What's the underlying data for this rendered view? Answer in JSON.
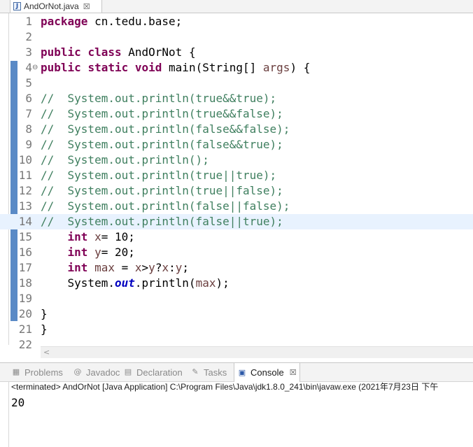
{
  "editor_tab": {
    "icon": "J",
    "label": "AndOrNot.java",
    "close": "☒"
  },
  "lines": [
    {
      "n": "1",
      "fold": "",
      "segs": [
        {
          "t": "package",
          "c": "kw"
        },
        {
          "t": " cn.tedu.base;",
          "c": ""
        }
      ]
    },
    {
      "n": "2",
      "fold": "",
      "segs": []
    },
    {
      "n": "3",
      "fold": "",
      "segs": [
        {
          "t": "public",
          "c": "kw"
        },
        {
          "t": " ",
          "c": ""
        },
        {
          "t": "class",
          "c": "kw"
        },
        {
          "t": " AndOrNot {",
          "c": ""
        }
      ]
    },
    {
      "n": "4",
      "fold": "⊖",
      "segs": [
        {
          "t": "public",
          "c": "kw"
        },
        {
          "t": " ",
          "c": ""
        },
        {
          "t": "static",
          "c": "kw"
        },
        {
          "t": " ",
          "c": ""
        },
        {
          "t": "void",
          "c": "kw"
        },
        {
          "t": " main(String[] ",
          "c": ""
        },
        {
          "t": "args",
          "c": "var"
        },
        {
          "t": ") {",
          "c": ""
        }
      ]
    },
    {
      "n": "5",
      "fold": "",
      "segs": []
    },
    {
      "n": "6",
      "fold": "",
      "segs": [
        {
          "t": "//  System.out.println(true&&true);",
          "c": "cm"
        }
      ]
    },
    {
      "n": "7",
      "fold": "",
      "segs": [
        {
          "t": "//  System.out.println(true&&false);",
          "c": "cm"
        }
      ]
    },
    {
      "n": "8",
      "fold": "",
      "segs": [
        {
          "t": "//  System.out.println(false&&false);",
          "c": "cm"
        }
      ]
    },
    {
      "n": "9",
      "fold": "",
      "segs": [
        {
          "t": "//  System.out.println(false&&true);",
          "c": "cm"
        }
      ]
    },
    {
      "n": "10",
      "fold": "",
      "segs": [
        {
          "t": "//  System.out.println();",
          "c": "cm"
        }
      ]
    },
    {
      "n": "11",
      "fold": "",
      "segs": [
        {
          "t": "//  System.out.println(true||true);",
          "c": "cm"
        }
      ]
    },
    {
      "n": "12",
      "fold": "",
      "segs": [
        {
          "t": "//  System.out.println(true||false);",
          "c": "cm"
        }
      ]
    },
    {
      "n": "13",
      "fold": "",
      "segs": [
        {
          "t": "//  System.out.println(false||false);",
          "c": "cm"
        }
      ]
    },
    {
      "n": "14",
      "fold": "",
      "current": true,
      "segs": [
        {
          "t": "//  System.out.println(false||true);",
          "c": "cm"
        }
      ]
    },
    {
      "n": "15",
      "fold": "",
      "segs": [
        {
          "t": "    ",
          "c": ""
        },
        {
          "t": "int",
          "c": "kw"
        },
        {
          "t": " ",
          "c": ""
        },
        {
          "t": "x",
          "c": "var"
        },
        {
          "t": "= 10;",
          "c": ""
        }
      ]
    },
    {
      "n": "16",
      "fold": "",
      "segs": [
        {
          "t": "    ",
          "c": ""
        },
        {
          "t": "int",
          "c": "kw"
        },
        {
          "t": " ",
          "c": ""
        },
        {
          "t": "y",
          "c": "var"
        },
        {
          "t": "= 20;",
          "c": ""
        }
      ]
    },
    {
      "n": "17",
      "fold": "",
      "segs": [
        {
          "t": "    ",
          "c": ""
        },
        {
          "t": "int",
          "c": "kw"
        },
        {
          "t": " ",
          "c": ""
        },
        {
          "t": "max",
          "c": "var"
        },
        {
          "t": " = ",
          "c": ""
        },
        {
          "t": "x",
          "c": "var"
        },
        {
          "t": ">",
          "c": ""
        },
        {
          "t": "y",
          "c": "var"
        },
        {
          "t": "?",
          "c": ""
        },
        {
          "t": "x",
          "c": "var"
        },
        {
          "t": ":",
          "c": ""
        },
        {
          "t": "y",
          "c": "var"
        },
        {
          "t": ";",
          "c": ""
        }
      ]
    },
    {
      "n": "18",
      "fold": "",
      "segs": [
        {
          "t": "    System.",
          "c": ""
        },
        {
          "t": "out",
          "c": "st"
        },
        {
          "t": ".println(",
          "c": ""
        },
        {
          "t": "max",
          "c": "var"
        },
        {
          "t": ");",
          "c": ""
        }
      ]
    },
    {
      "n": "19",
      "fold": "",
      "segs": []
    },
    {
      "n": "20",
      "fold": "",
      "segs": [
        {
          "t": "}",
          "c": ""
        }
      ]
    },
    {
      "n": "21",
      "fold": "",
      "segs": [
        {
          "t": "}",
          "c": ""
        }
      ]
    },
    {
      "n": "22",
      "fold": "",
      "segs": []
    }
  ],
  "scroll_arrow": "<",
  "panel_tabs": [
    {
      "name": "tab-problems",
      "icon": "problems-icon",
      "glyph": "▦",
      "label": "Problems",
      "active": false
    },
    {
      "name": "tab-javadoc",
      "icon": "javadoc-icon",
      "glyph": "@",
      "label": "Javadoc",
      "active": false
    },
    {
      "name": "tab-declaration",
      "icon": "declaration-icon",
      "glyph": "▤",
      "label": "Declaration",
      "active": false
    },
    {
      "name": "tab-tasks",
      "icon": "tasks-icon",
      "glyph": "✎",
      "label": "Tasks",
      "active": false
    },
    {
      "name": "tab-console",
      "icon": "console-icon",
      "glyph": "▣",
      "label": "Console",
      "active": true,
      "close": "☒"
    }
  ],
  "console": {
    "header": "<terminated> AndOrNot [Java Application] C:\\Program Files\\Java\\jdk1.8.0_241\\bin\\javaw.exe (2021年7月23日 下午",
    "output": "20"
  },
  "colors": {
    "keyword": "#7f0055",
    "comment": "#3f7f5f",
    "variable": "#6a3e3e",
    "static_field": "#0000c0",
    "range_indicator": "#5a8ac6",
    "current_line": "#e8f2fe"
  }
}
